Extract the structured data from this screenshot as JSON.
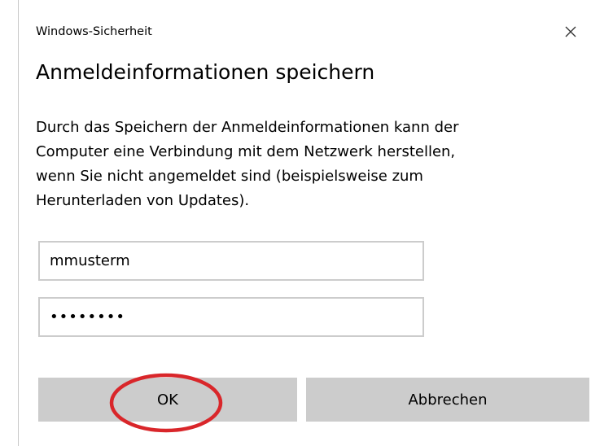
{
  "window": {
    "title": "Windows-Sicherheit",
    "close_icon": "close-icon"
  },
  "dialog": {
    "heading": "Anmeldeinformationen speichern",
    "description_lines": [
      "Durch das Speichern der Anmeldeinformationen kann der",
      "Computer eine Verbindung mit dem Netzwerk herstellen,",
      "wenn Sie nicht angemeldet sind (beispielsweise zum",
      "Herunterladen von Updates)."
    ]
  },
  "fields": {
    "username_value": "mmusterm",
    "password_value": "••••••••"
  },
  "buttons": {
    "ok_label": "OK",
    "cancel_label": "Abbrechen"
  },
  "colors": {
    "button_background": "#cccccc",
    "field_border": "#cccccc",
    "annotation_circle": "#d9262a"
  }
}
